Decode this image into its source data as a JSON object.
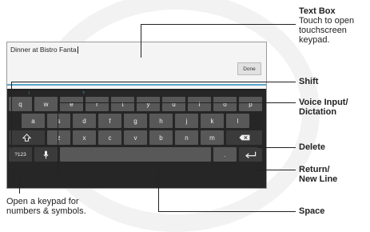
{
  "textbox": {
    "value": "Dinner at Bistro Fanta",
    "done_label": "Done"
  },
  "keyboard": {
    "hints": [
      "!",
      "?",
      ",",
      "-",
      ":",
      ";",
      "'",
      "\""
    ],
    "row1": [
      "q",
      "w",
      "e",
      "r",
      "t",
      "y",
      "u",
      "i",
      "o",
      "p"
    ],
    "row2": [
      "a",
      "s",
      "d",
      "f",
      "g",
      "h",
      "j",
      "k",
      "l"
    ],
    "row3": [
      "z",
      "x",
      "c",
      "v",
      "b",
      "n",
      "m"
    ],
    "symbols_label": "?123",
    "period_label": "."
  },
  "callouts": {
    "text_box": {
      "title": "Text Box",
      "desc1": "Touch to open",
      "desc2": "touchscreen",
      "desc3": "keypad."
    },
    "shift": "Shift",
    "voice1": "Voice Input/",
    "voice2": "Dictation",
    "delete": "Delete",
    "return1": "Return/",
    "return2": "New Line",
    "space": "Space",
    "keypad1": "Open a keypad for",
    "keypad2": "numbers & symbols."
  },
  "icons": [
    "shift-icon",
    "microphone-icon",
    "backspace-icon",
    "return-icon"
  ]
}
